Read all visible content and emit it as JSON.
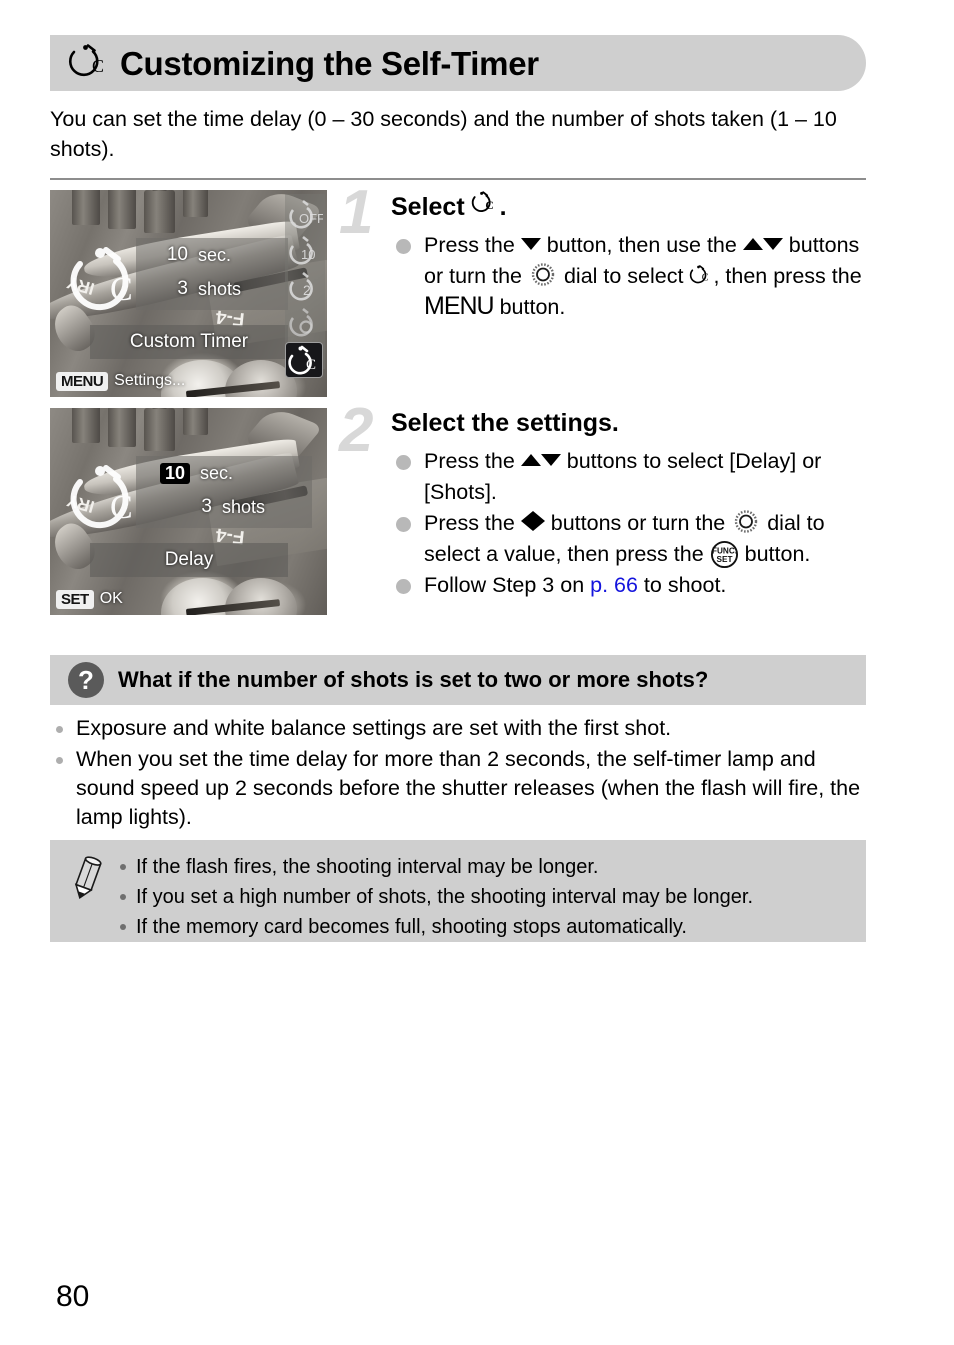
{
  "page": {
    "number": "80",
    "title": "Customizing the Self-Timer",
    "title_icon": "custom-self-timer-icon",
    "intro": "You can set the time delay (0 – 30 seconds) and the number of shots taken (1 – 10 shots)."
  },
  "steps": [
    {
      "number": "1",
      "title_prefix": "Select",
      "title_suffix": ".",
      "title_icon": "custom-self-timer-icon",
      "bullets": [
        {
          "parts": [
            {
              "type": "text",
              "value": "Press the "
            },
            {
              "type": "icon",
              "value": "down-arrow-button-icon"
            },
            {
              "type": "text",
              "value": " button, then use the "
            },
            {
              "type": "icon",
              "value": "up-arrow-button-icon"
            },
            {
              "type": "icon",
              "value": "down-arrow-button-icon"
            },
            {
              "type": "text",
              "value": " buttons or turn the "
            },
            {
              "type": "icon",
              "value": "control-dial-icon"
            },
            {
              "type": "text",
              "value": " dial to select "
            },
            {
              "type": "icon",
              "value": "custom-self-timer-icon"
            },
            {
              "type": "text",
              "value": ", then press the "
            },
            {
              "type": "word",
              "value": "MENU"
            },
            {
              "type": "text",
              "value": " button."
            }
          ]
        }
      ],
      "screen": {
        "delay_value": "10",
        "delay_unit": "sec.",
        "shots_value": "3",
        "shots_unit": "shots",
        "mode_label": "Custom Timer",
        "selected_field": "none",
        "badge_key": "MENU",
        "badge_text": "Settings...",
        "rail_items": [
          "timer-off-icon",
          "timer-10sec-icon",
          "timer-2sec-icon",
          "face-self-timer-icon",
          "custom-self-timer-icon"
        ],
        "rail_active_index": 4
      }
    },
    {
      "number": "2",
      "title_prefix": "Select the settings.",
      "title_suffix": "",
      "title_icon": "",
      "bullets": [
        {
          "parts": [
            {
              "type": "text",
              "value": "Press the "
            },
            {
              "type": "icon",
              "value": "up-arrow-button-icon"
            },
            {
              "type": "icon",
              "value": "down-arrow-button-icon"
            },
            {
              "type": "text",
              "value": " buttons to select [Delay] or [Shots]."
            }
          ]
        },
        {
          "parts": [
            {
              "type": "text",
              "value": "Press the "
            },
            {
              "type": "icon",
              "value": "left-arrow-button-icon"
            },
            {
              "type": "icon",
              "value": "right-arrow-button-icon"
            },
            {
              "type": "text",
              "value": " buttons or turn the "
            },
            {
              "type": "icon",
              "value": "control-dial-icon"
            },
            {
              "type": "text",
              "value": " dial to select a value, then press the "
            },
            {
              "type": "icon",
              "value": "func-set-button-icon"
            },
            {
              "type": "text",
              "value": " button."
            }
          ]
        },
        {
          "parts": [
            {
              "type": "text",
              "value": "Follow Step 3 on "
            },
            {
              "type": "link",
              "value": "p. 66"
            },
            {
              "type": "text",
              "value": " to shoot."
            }
          ]
        }
      ],
      "screen": {
        "delay_value": "10",
        "delay_unit": "sec.",
        "shots_value": "3",
        "shots_unit": "shots",
        "mode_label": "Delay",
        "selected_field": "delay",
        "badge_key": "SET",
        "badge_text": "OK",
        "rail_items": [],
        "rail_active_index": -1
      }
    }
  ],
  "qa": {
    "icon": "question-mark-icon",
    "title": "What if the number of shots is set to two or more shots?",
    "items": [
      "Exposure and white balance settings are set with the first shot.",
      "When you set the time delay for more than 2 seconds, the self-timer lamp and sound speed up 2 seconds before the shutter releases (when the flash will fire, the lamp lights)."
    ]
  },
  "note": {
    "icon": "pencil-icon",
    "items": [
      "If the flash fires, the shooting interval may be longer.",
      "If you set a high number of shots, the shooting interval may be longer.",
      "If the memory card becomes full, shooting stops automatically."
    ]
  },
  "colors": {
    "band": "#cfcfcf",
    "step_number": "#d8d8d8",
    "link": "#1414dd",
    "bullet": "#b8b8b8",
    "divider": "#8d8d8d"
  },
  "photo_decals": {
    "wing_left": "IRY",
    "wing_right": "F-4"
  }
}
